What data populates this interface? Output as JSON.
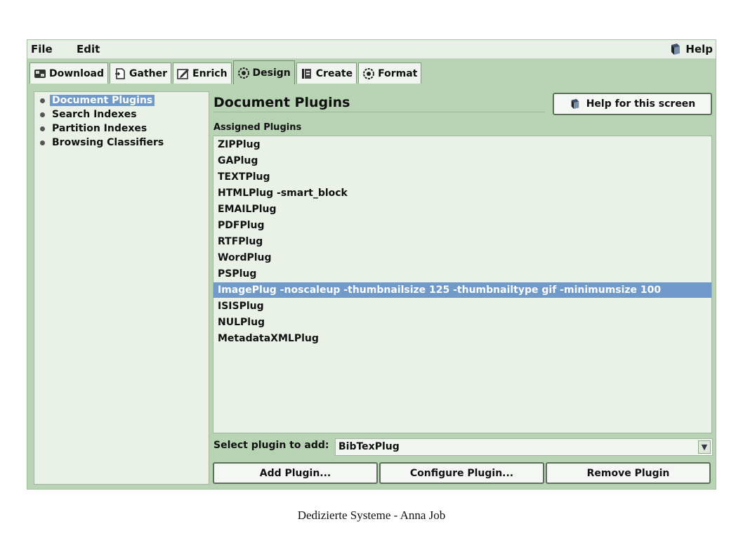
{
  "menu": {
    "file": "File",
    "edit": "Edit",
    "help": "Help"
  },
  "tabs": [
    {
      "label": "Download",
      "icon": "download-icon"
    },
    {
      "label": "Gather",
      "icon": "gather-icon"
    },
    {
      "label": "Enrich",
      "icon": "enrich-icon"
    },
    {
      "label": "Design",
      "icon": "gear-icon",
      "active": true
    },
    {
      "label": "Create",
      "icon": "create-icon"
    },
    {
      "label": "Format",
      "icon": "gear-icon"
    }
  ],
  "tree": [
    {
      "label": "Document Plugins",
      "selected": true
    },
    {
      "label": "Search Indexes"
    },
    {
      "label": "Partition Indexes"
    },
    {
      "label": "Browsing Classifiers"
    }
  ],
  "main": {
    "title": "Document Plugins",
    "help_button": "Help for this screen",
    "assigned_label": "Assigned Plugins",
    "plugins": [
      "ZIPPlug",
      "GAPlug",
      "TEXTPlug",
      "HTMLPlug -smart_block",
      "EMAILPlug",
      "PDFPlug",
      "RTFPlug",
      "WordPlug",
      "PSPlug",
      "ImagePlug -noscaleup -thumbnailsize 125 -thumbnailtype gif -minimumsize 100",
      "ISISPlug",
      "NULPlug",
      "MetadataXMLPlug"
    ],
    "selected_plugin_index": 9,
    "select_label": "Select plugin to add:",
    "select_value": "BibTexPlug",
    "buttons": {
      "add": "Add Plugin...",
      "configure": "Configure Plugin...",
      "remove": "Remove Plugin"
    }
  },
  "caption": "Dedizierte Systeme - Anna Job",
  "colors": {
    "panel_bg": "#b7d3b4",
    "selection": "#6f9ac9",
    "list_bg": "#eaf2e8"
  }
}
